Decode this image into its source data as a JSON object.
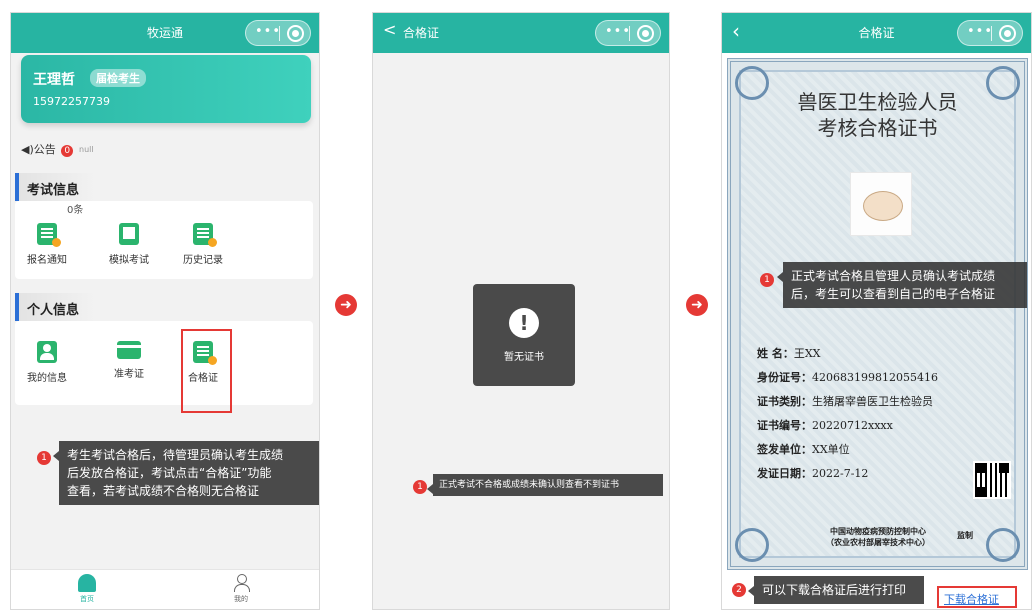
{
  "screen1": {
    "title": "牧运通",
    "user_name": "王理哲",
    "user_badge": "届检考生",
    "phone": "15972257739",
    "notice_label": "◀)公告",
    "notice_count": "0",
    "notice_null": "null",
    "exam_section": "考试信息",
    "exam_count": "0条",
    "exam_items": [
      "报名通知",
      "模拟考试",
      "历史记录"
    ],
    "personal_section": "个人信息",
    "personal_items": [
      "我的信息",
      "准考证",
      "合格证"
    ],
    "tip_num": "1",
    "tip_lines": [
      "考生考试合格后，待管理员确认考生成绩",
      "后发放合格证，考试点击“合格证”功能",
      "查看，若考试成绩不合格则无合格证"
    ],
    "tabs": [
      "首页",
      "我的"
    ]
  },
  "screen2": {
    "title": "合格证",
    "toast_text": "暂无证书",
    "tip_num": "1",
    "tip_text": "正式考试不合格或成绩未确认则查看不到证书"
  },
  "screen3": {
    "title": "合格证",
    "cert_title_1": "兽医卫生检验人员",
    "cert_title_2": "考核合格证书",
    "tip_num": "1",
    "tip_lines": [
      "正式考试合格且管理人员确认考试成绩",
      "后，考生可以查看到自己的电子合格证"
    ],
    "fields": [
      {
        "label": "姓    名：",
        "value": "王XX"
      },
      {
        "label": "身份证号：",
        "value": "420683199812055416"
      },
      {
        "label": "证书类别：",
        "value": "生猪屠宰兽医卫生检验员"
      },
      {
        "label": "证书编号：",
        "value": "20220712xxxx"
      },
      {
        "label": "签发单位：",
        "value": "XX单位"
      },
      {
        "label": "发证日期：",
        "value": "2022-7-12"
      }
    ],
    "issuer_line1": "中国动物疫病预防控制中心",
    "issuer_line2": "（农业农村部屠宰技术中心）",
    "seal_text": "监制",
    "tip2_num": "2",
    "tip2_text": "可以下载合格证后进行打印",
    "download_link": "下载合格证"
  },
  "colors": {
    "brand": "#27b4a2",
    "accent": "#e53935",
    "link": "#2b6fd6"
  }
}
